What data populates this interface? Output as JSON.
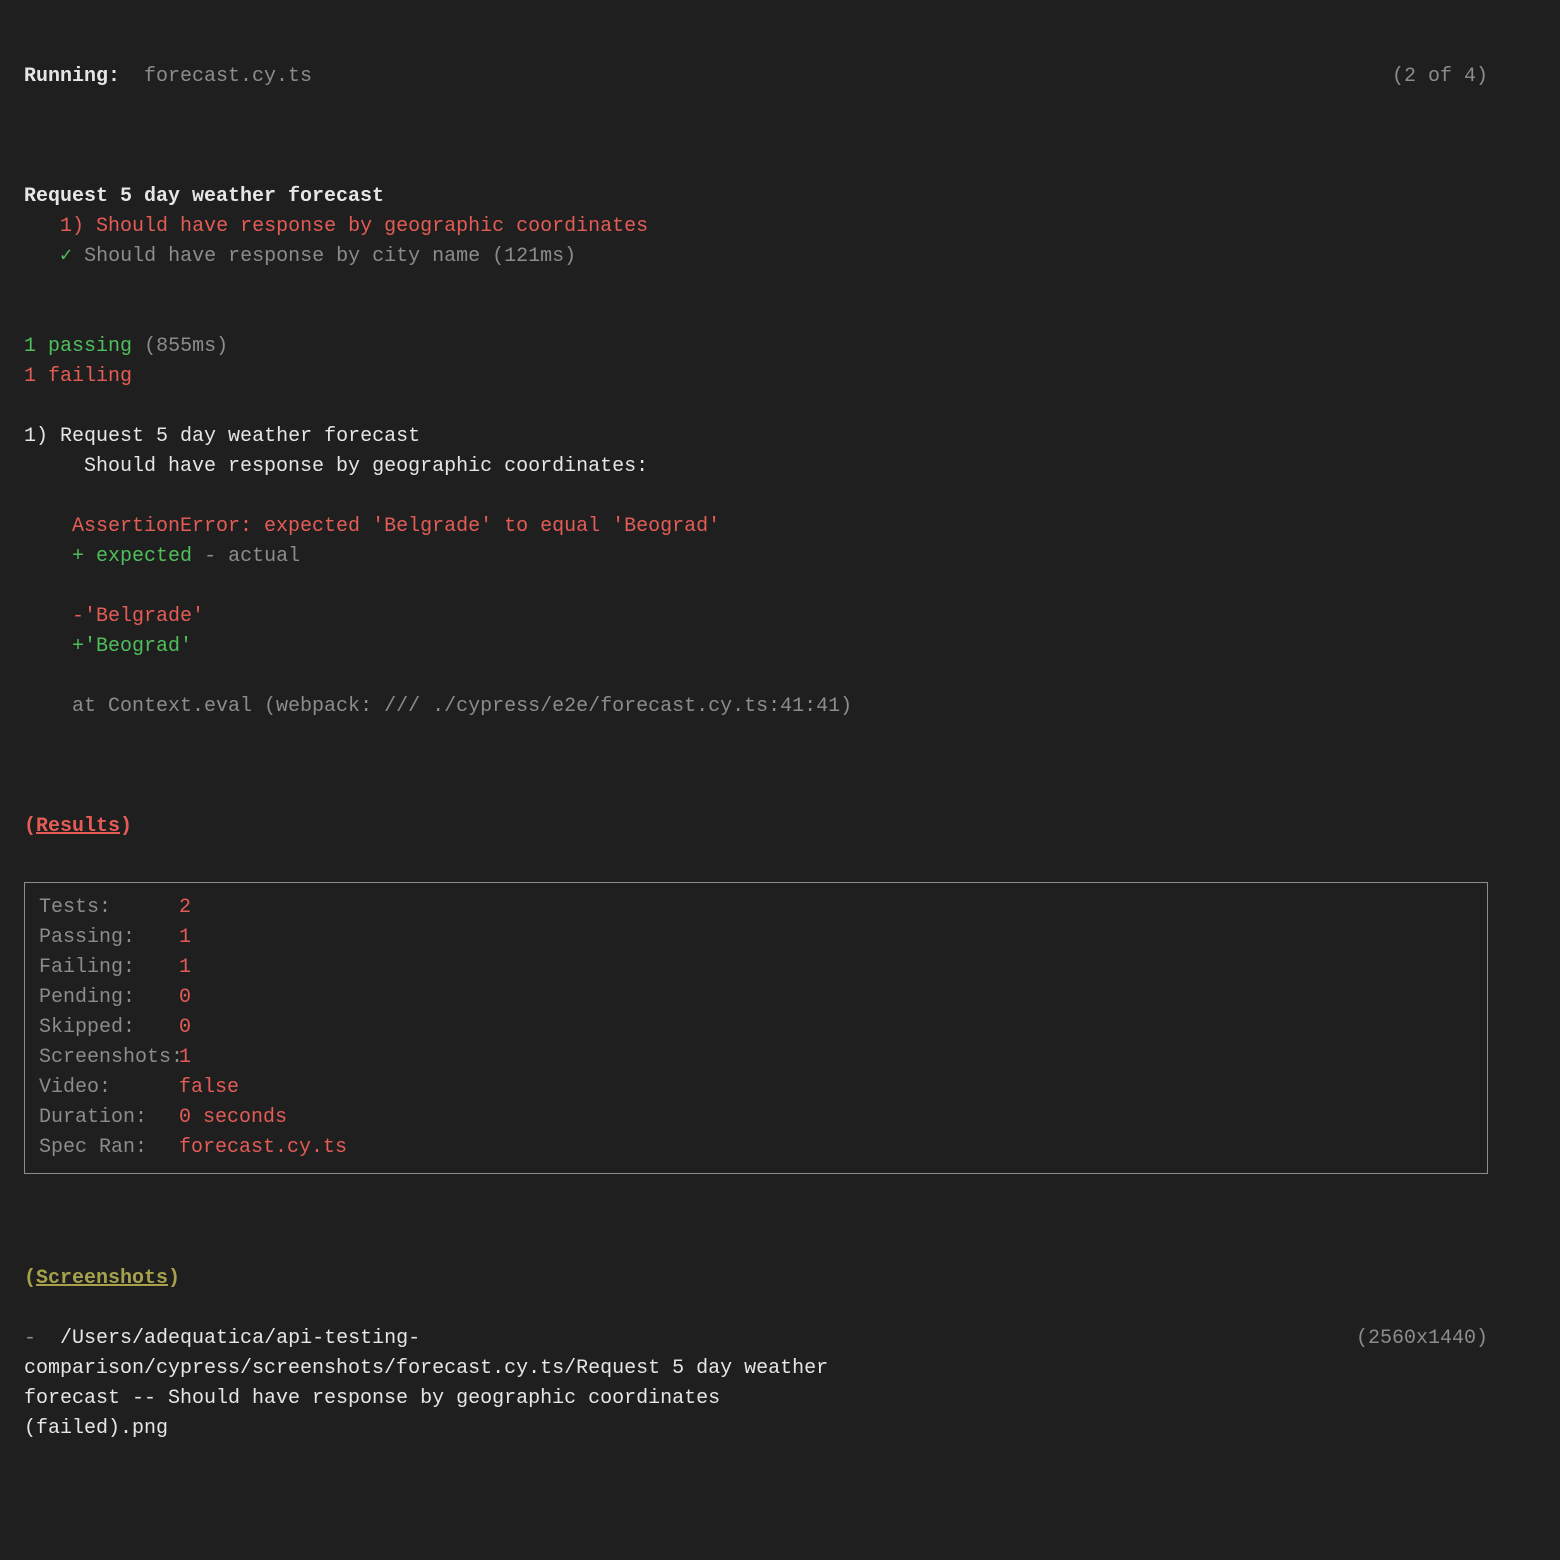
{
  "header": {
    "running_label": "Running:",
    "spec_file": "forecast.cy.ts",
    "progress": "(2 of 4)"
  },
  "suite": {
    "title": "Request 5 day weather forecast",
    "fail_index": "1)",
    "fail_name": "Should have response by geographic coordinates",
    "pass_mark": "✓",
    "pass_name": "Should have response by city name (121ms)"
  },
  "summary": {
    "pass_count": "1",
    "pass_label": "passing",
    "pass_time": "(855ms)",
    "fail_count": "1",
    "fail_label": "failing"
  },
  "failure": {
    "index": "1)",
    "suite": "Request 5 day weather forecast",
    "test": "Should have response by geographic coordinates:",
    "error": "AssertionError: expected 'Belgrade' to equal 'Beograd'",
    "diff_plus": "+",
    "expected_label": "expected",
    "diff_minus": "-",
    "actual_label": "actual",
    "actual_line": "-'Belgrade'",
    "expected_line": "+'Beograd'",
    "stack": "at Context.eval (webpack: /// ./cypress/e2e/forecast.cy.ts:41:41)"
  },
  "sections": {
    "results_paren_open": "(",
    "results_label": "Results",
    "results_paren_close": ")",
    "screenshots_paren_open": "(",
    "screenshots_label": "Screenshots",
    "screenshots_paren_close": ")"
  },
  "results": [
    {
      "k": "Tests:",
      "v": "2"
    },
    {
      "k": "Passing:",
      "v": "1"
    },
    {
      "k": "Failing:",
      "v": "1"
    },
    {
      "k": "Pending:",
      "v": "0"
    },
    {
      "k": "Skipped:",
      "v": "0"
    },
    {
      "k": "Screenshots:",
      "v": "1"
    },
    {
      "k": "Video:",
      "v": "false"
    },
    {
      "k": "Duration:",
      "v": "0 seconds"
    },
    {
      "k": "Spec Ran:",
      "v": "forecast.cy.ts"
    }
  ],
  "screenshots": {
    "bullet": "-",
    "path": "/Users/adequatica/api-testing-comparison/cypress/screenshots/forecast.cy.ts/Request 5 day weather forecast -- Should have response by geographic coordinates (failed).png",
    "dimensions": "(2560x1440)"
  }
}
